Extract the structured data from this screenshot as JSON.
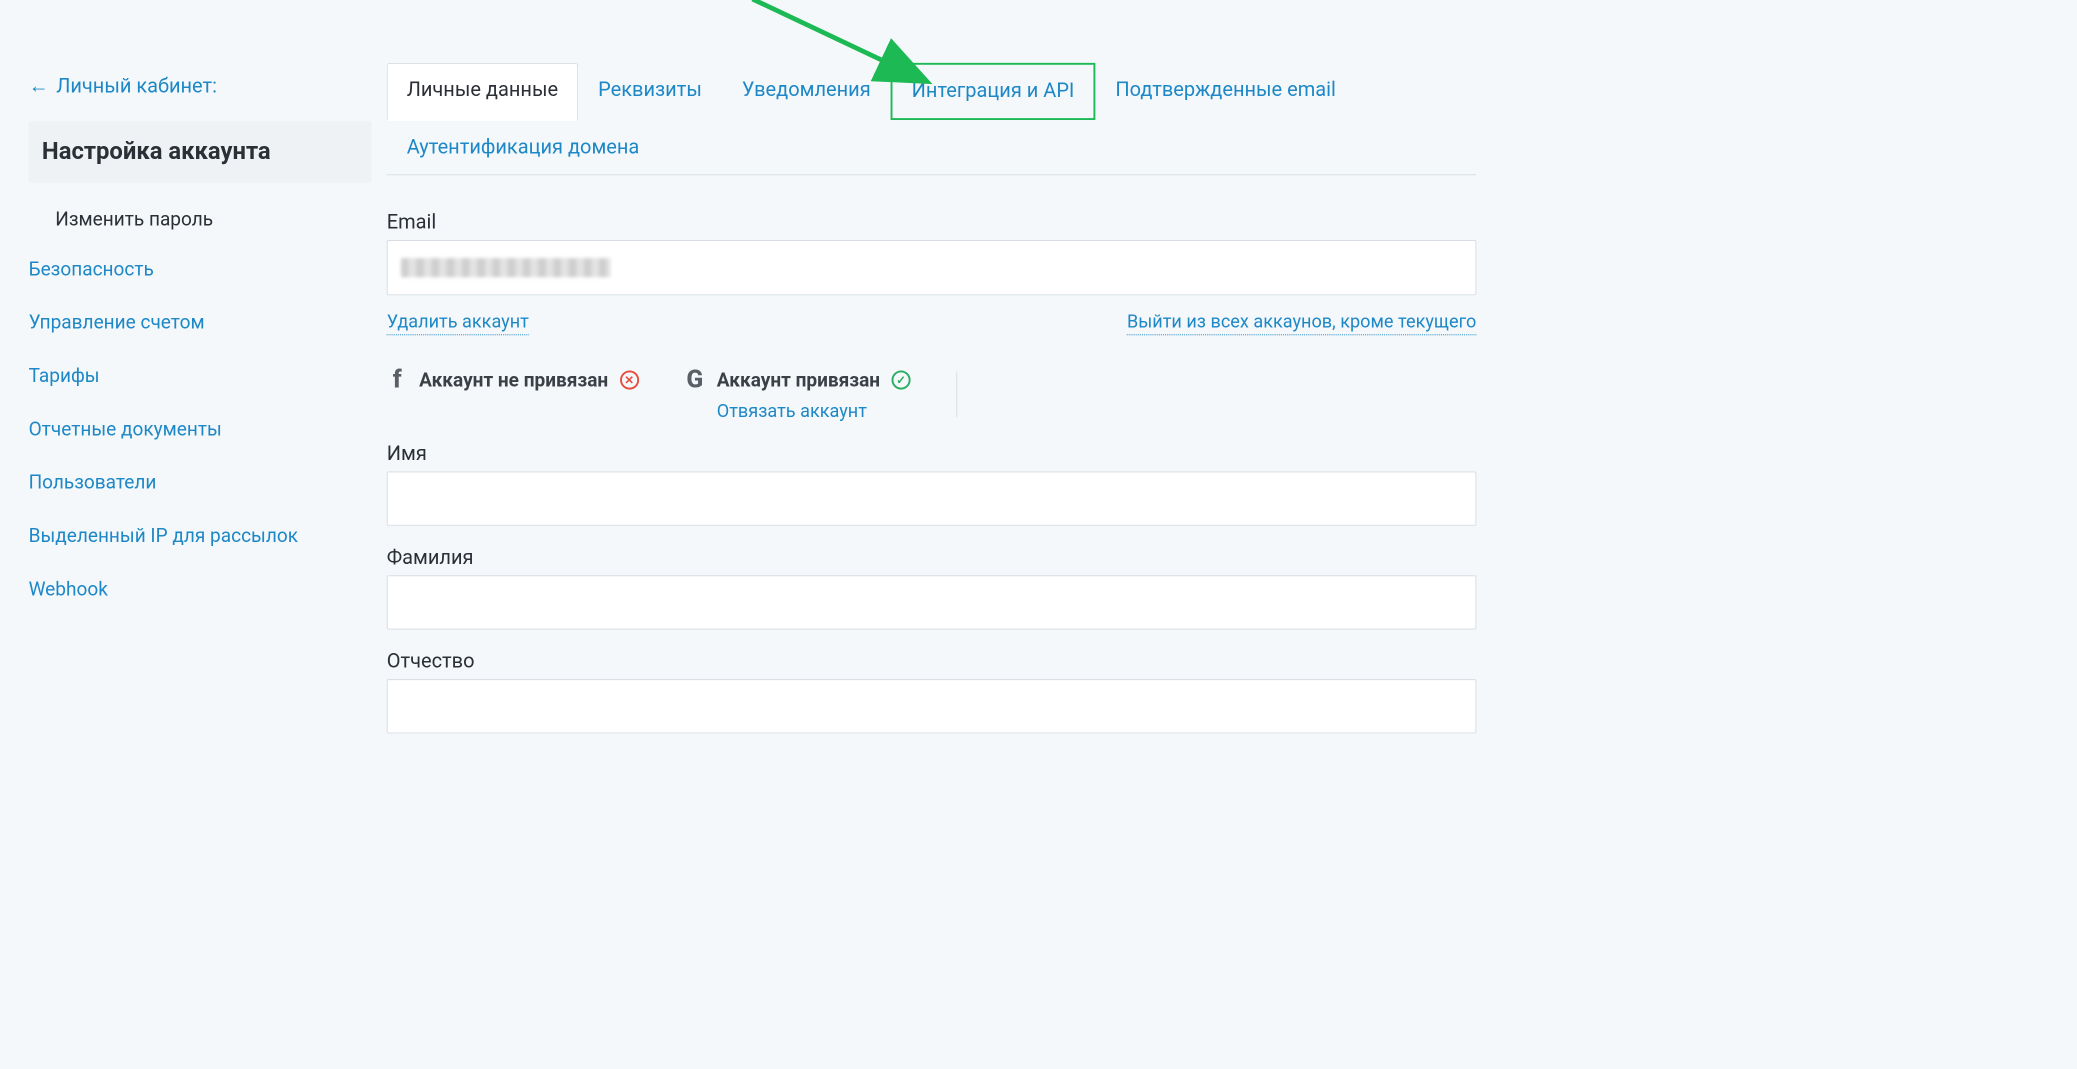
{
  "back_link": "Личный кабинет:",
  "page_title": "Настройка аккаунта",
  "sidebar": {
    "change_password": "Изменить пароль",
    "items": [
      "Безопасность",
      "Управление счетом",
      "Тарифы",
      "Отчетные документы",
      "Пользователи",
      "Выделенный IP для рассылок",
      "Webhook"
    ]
  },
  "tabs": [
    "Личные данные",
    "Реквизиты",
    "Уведомления",
    "Интеграция и API",
    "Подтвержденные email",
    "Аутентификация домена"
  ],
  "active_tab_index": 0,
  "highlighted_tab_index": 3,
  "form": {
    "email_label": "Email",
    "delete_account": "Удалить аккаунт",
    "logout_all": "Выйти из всех аккаунов, кроме текущего",
    "fb_status": "Аккаунт не привязан",
    "g_status": "Аккаунт привязан",
    "unlink": "Отвязать аккаунт",
    "name_label": "Имя",
    "surname_label": "Фамилия",
    "patronymic_label": "Отчество"
  }
}
